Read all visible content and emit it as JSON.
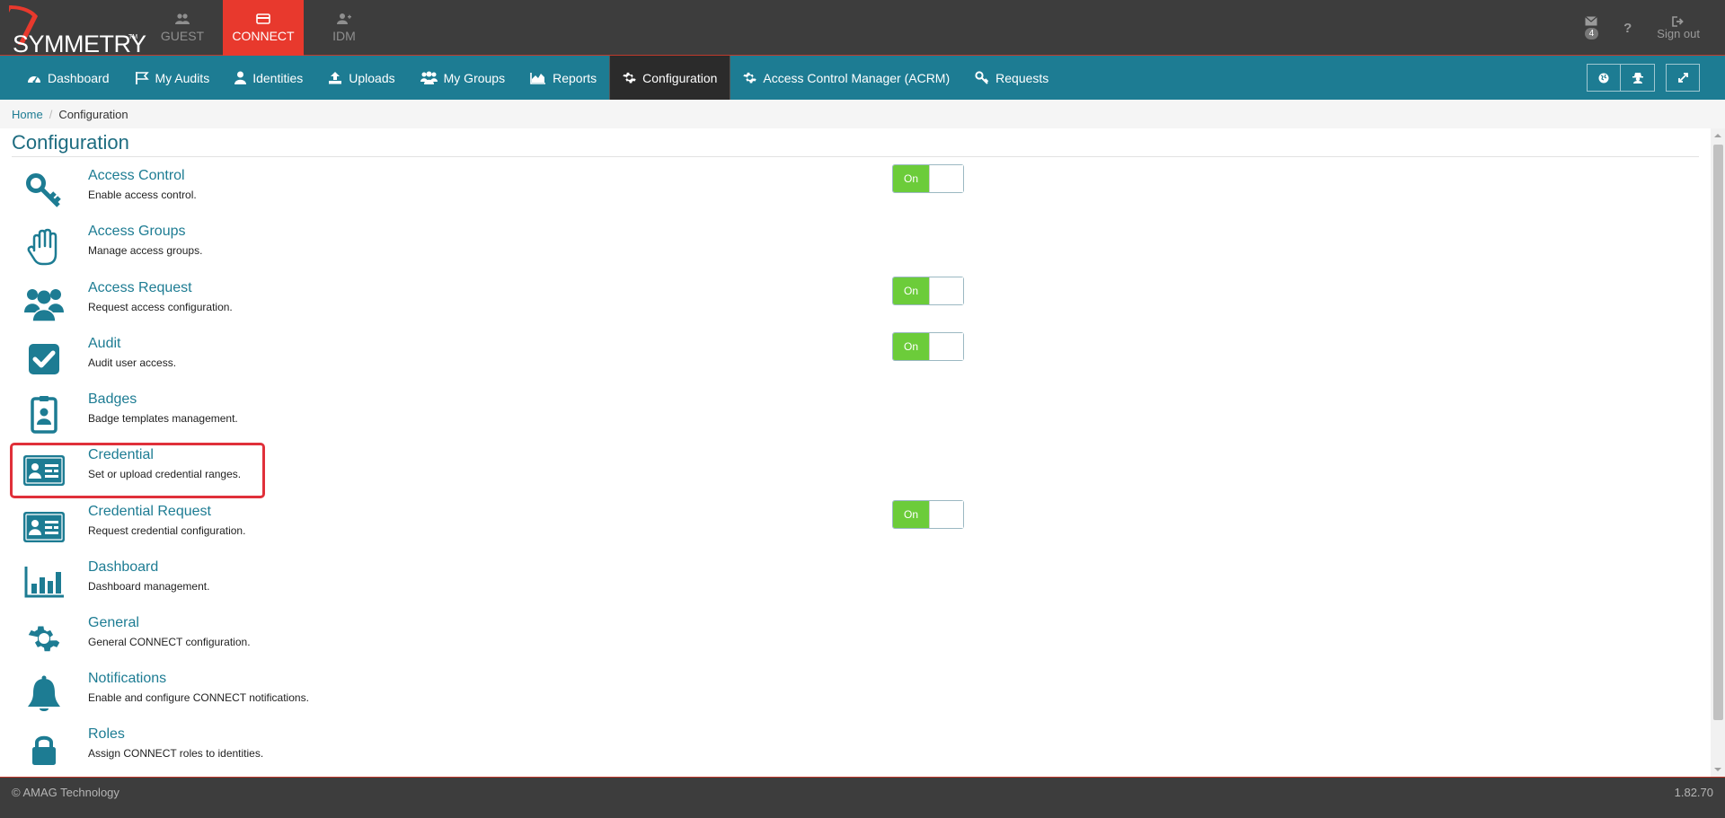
{
  "header": {
    "logo_text": "SYMMETRY",
    "logo_tm": "TM",
    "app_tabs": [
      {
        "label": "GUEST",
        "icon": "users-icon"
      },
      {
        "label": "CONNECT",
        "icon": "card-icon",
        "active": true
      },
      {
        "label": "IDM",
        "icon": "user-add-icon"
      }
    ],
    "mail_count": "4",
    "help_label": "?",
    "signout_label": "Sign out"
  },
  "nav": {
    "items": [
      {
        "label": "Dashboard",
        "icon": "dashboard-icon"
      },
      {
        "label": "My Audits",
        "icon": "flag-icon"
      },
      {
        "label": "Identities",
        "icon": "user-icon"
      },
      {
        "label": "Uploads",
        "icon": "upload-icon"
      },
      {
        "label": "My Groups",
        "icon": "group-icon"
      },
      {
        "label": "Reports",
        "icon": "area-chart-icon"
      },
      {
        "label": "Configuration",
        "icon": "gear-icon",
        "active": true
      },
      {
        "label": "Access Control Manager (ACRM)",
        "icon": "gear-icon"
      },
      {
        "label": "Requests",
        "icon": "key-icon"
      }
    ]
  },
  "breadcrumb": {
    "home": "Home",
    "separator": "/",
    "current": "Configuration"
  },
  "page": {
    "title": "Configuration",
    "items": [
      {
        "title": "Access Control",
        "desc": "Enable access control.",
        "icon": "key-icon",
        "toggle": "On"
      },
      {
        "title": "Access Groups",
        "desc": "Manage access groups.",
        "icon": "hand-icon"
      },
      {
        "title": "Access Request",
        "desc": "Request access configuration.",
        "icon": "people-icon",
        "toggle": "On"
      },
      {
        "title": "Audit",
        "desc": "Audit user access.",
        "icon": "checkbox-icon",
        "toggle": "On"
      },
      {
        "title": "Badges",
        "desc": "Badge templates management.",
        "icon": "badge-icon"
      },
      {
        "title": "Credential",
        "desc": "Set or upload credential ranges.",
        "icon": "id-card-icon",
        "highlighted": true
      },
      {
        "title": "Credential Request",
        "desc": "Request credential configuration.",
        "icon": "id-card-icon",
        "toggle": "On"
      },
      {
        "title": "Dashboard",
        "desc": "Dashboard management.",
        "icon": "bar-chart-icon"
      },
      {
        "title": "General",
        "desc": "General CONNECT configuration.",
        "icon": "gear-icon"
      },
      {
        "title": "Notifications",
        "desc": "Enable and configure CONNECT notifications.",
        "icon": "bell-icon"
      },
      {
        "title": "Roles",
        "desc": "Assign CONNECT roles to identities.",
        "icon": "lock-icon"
      }
    ]
  },
  "footer": {
    "copyright": "© AMAG Technology",
    "version": "1.82.70"
  },
  "colors": {
    "primary": "#1d7c93",
    "accent": "#e8392d",
    "toggle_on": "#6ccc3a",
    "dark": "#3d3d3d"
  }
}
